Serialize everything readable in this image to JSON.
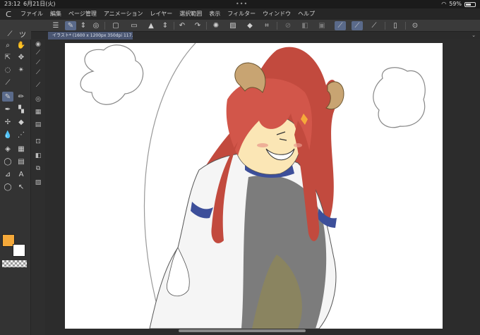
{
  "status_bar": {
    "time": "23:12",
    "date": "6月21日(火)",
    "battery": "59%"
  },
  "menu": {
    "items": [
      "ファイル",
      "編集",
      "ページ管理",
      "アニメーション",
      "レイヤー",
      "選択範囲",
      "表示",
      "フィルター",
      "ウィンドウ",
      "ヘルプ"
    ]
  },
  "document_tab": {
    "title": "イラスト* (1600 x 1200px 350dpi 117.8%)"
  },
  "colors": {
    "main": "#f5a93a",
    "sub": "#ffffff",
    "accent": "#5a6a8a"
  },
  "toolbar_icons": [
    "menu-icon",
    "canvas-icon",
    "new-icon",
    "open-icon",
    "save-icon",
    "undo-icon",
    "redo-icon",
    "clear-icon",
    "transform-icon",
    "fill-icon",
    "crop-icon",
    "pen-snap-icon",
    "ruler-icon",
    "settings-icon"
  ]
}
